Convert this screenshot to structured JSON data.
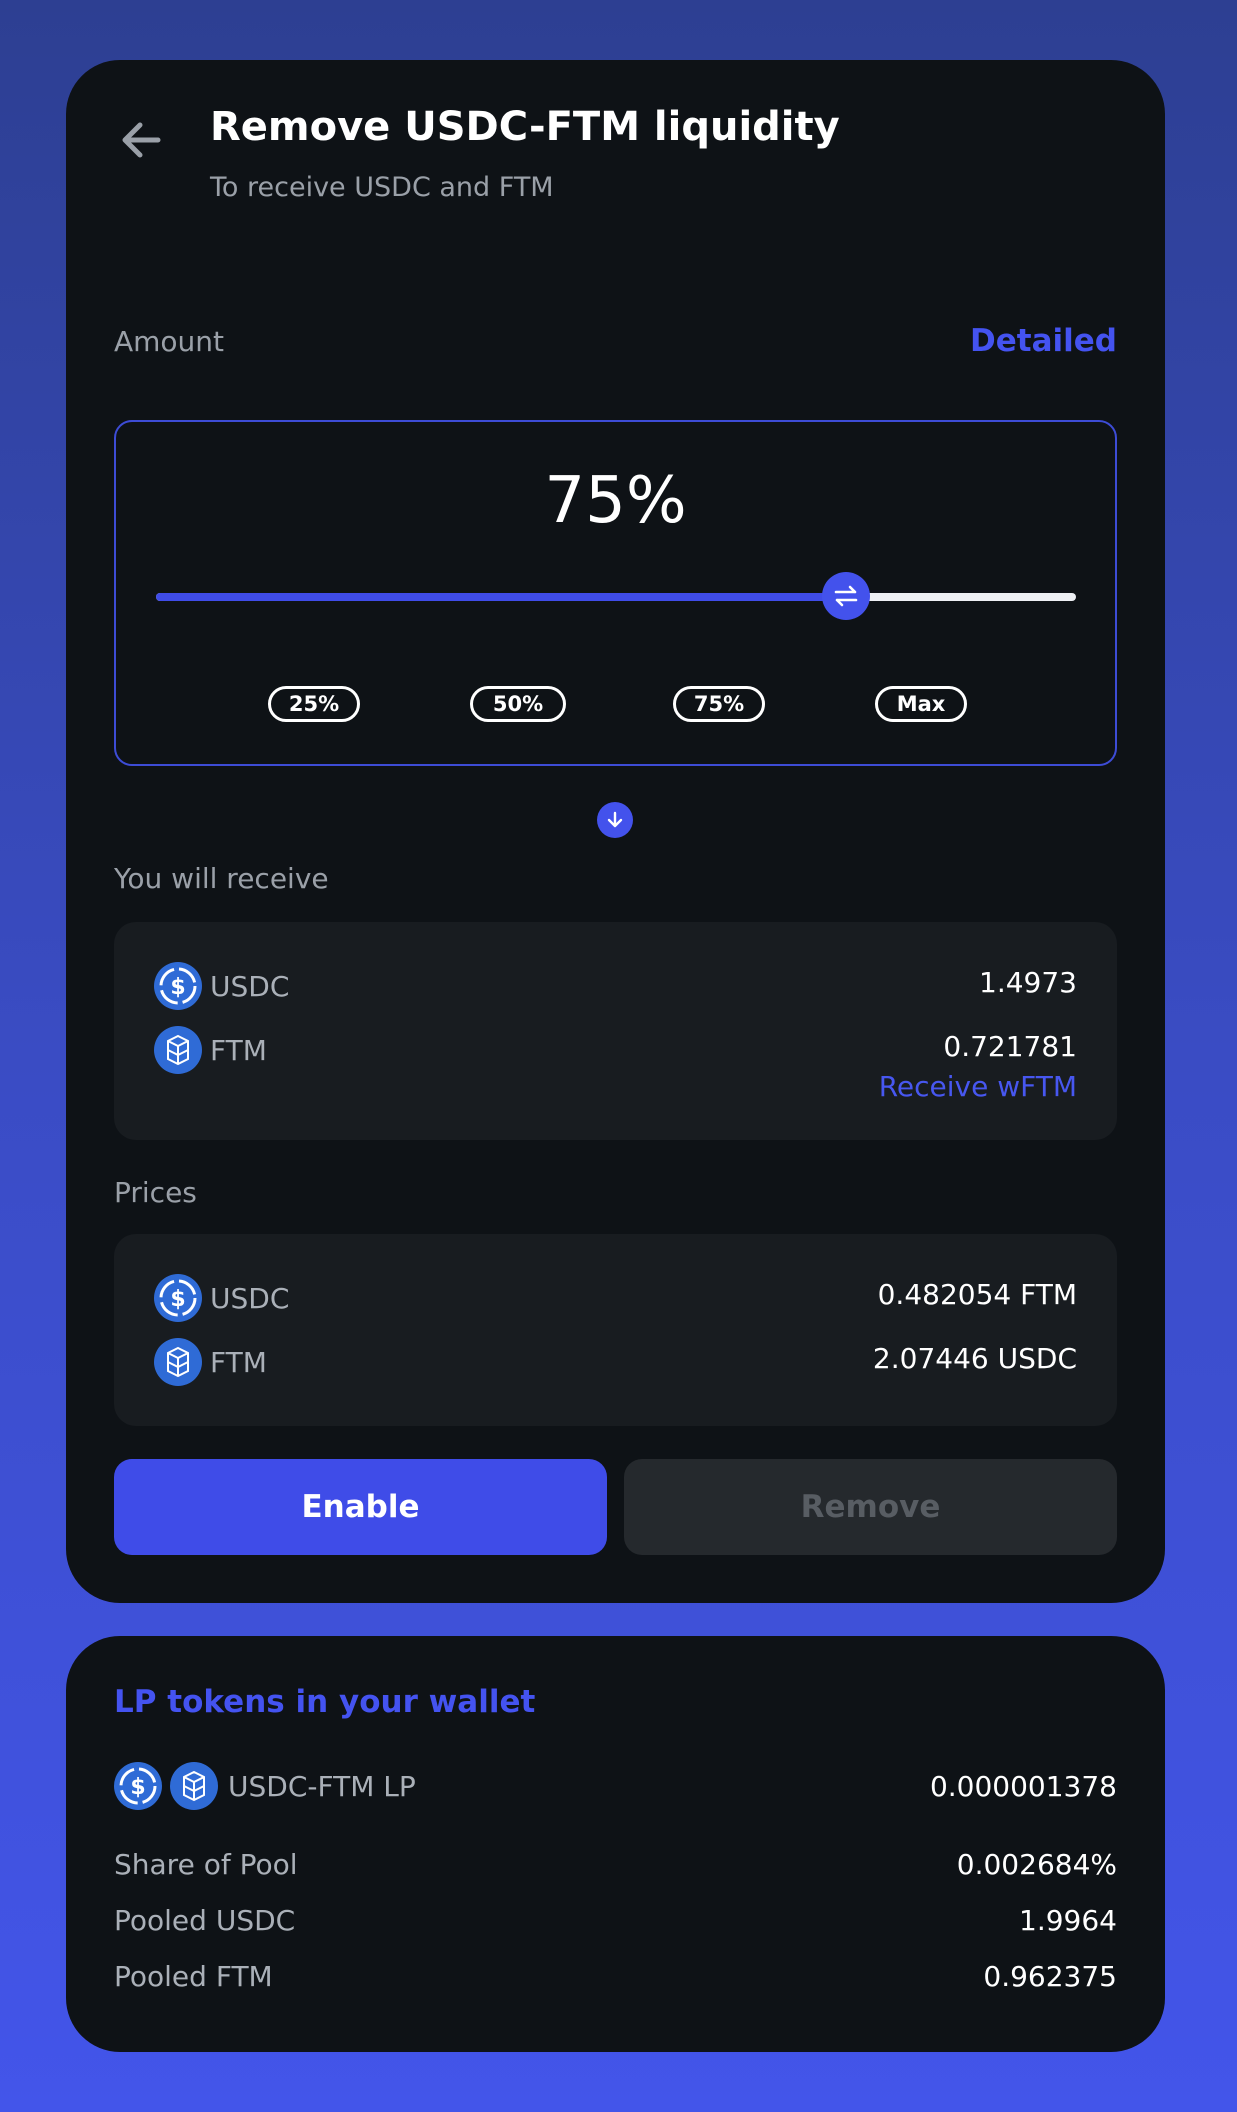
{
  "header": {
    "title": "Remove USDC-FTM liquidity",
    "subtitle": "To receive USDC and FTM"
  },
  "amount": {
    "label": "Amount",
    "detailed_link": "Detailed",
    "percent_text": "75%",
    "percent_value": 75,
    "presets": [
      "25%",
      "50%",
      "75%",
      "Max"
    ]
  },
  "receive": {
    "label": "You will receive",
    "tokens": [
      {
        "symbol": "USDC",
        "amount": "1.4973"
      },
      {
        "symbol": "FTM",
        "amount": "0.721781"
      }
    ],
    "wrap_link": "Receive wFTM"
  },
  "prices": {
    "label": "Prices",
    "rows": [
      {
        "symbol": "USDC",
        "price": "0.482054 FTM"
      },
      {
        "symbol": "FTM",
        "price": "2.07446 USDC"
      }
    ]
  },
  "actions": {
    "enable_label": "Enable",
    "remove_label": "Remove"
  },
  "lp_wallet": {
    "title": "LP tokens in your wallet",
    "pair_label": "USDC-FTM LP",
    "pair_amount": "0.000001378",
    "stats": [
      {
        "label": "Share of Pool",
        "value": "0.002684%"
      },
      {
        "label": "Pooled USDC",
        "value": "1.9964"
      },
      {
        "label": "Pooled FTM",
        "value": "0.962375"
      }
    ]
  },
  "colors": {
    "accent": "#3f4ce8",
    "card_bg": "#0e1216",
    "panel_bg": "#181c20"
  },
  "icons": {
    "back": "arrow-left-icon",
    "thumb": "swap-arrows-icon",
    "down": "arrow-down-icon",
    "usdc": "usdc-coin-icon",
    "ftm": "fantom-coin-icon"
  }
}
